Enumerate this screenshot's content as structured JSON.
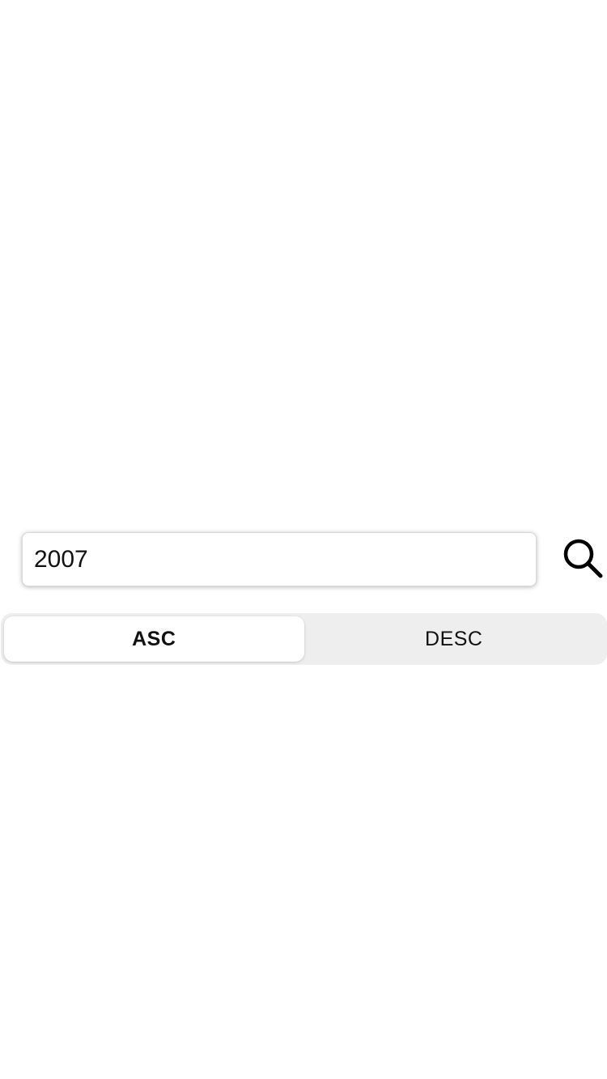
{
  "search": {
    "value": "2007",
    "icon": "search-icon"
  },
  "sort_order": {
    "options": [
      "ASC",
      "DESC"
    ],
    "selected": "ASC"
  }
}
